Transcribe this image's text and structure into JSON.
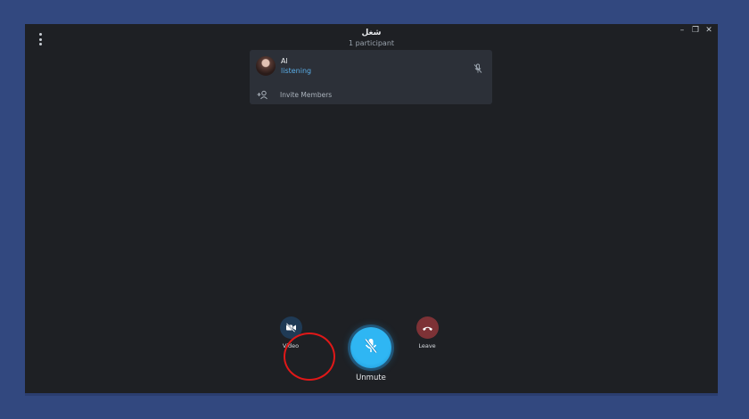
{
  "window": {
    "title": "شغل",
    "subtitle": "1 participant",
    "controls": {
      "minimize": "–",
      "maximize": "❐",
      "close": "✕"
    }
  },
  "participants": [
    {
      "name": "Al",
      "status": "listening",
      "muted": true
    }
  ],
  "invite": {
    "label": "Invite Members"
  },
  "controls": {
    "video_label": "Video",
    "unmute_label": "Unmute",
    "leave_label": "Leave"
  },
  "colors": {
    "accent": "#2fb6f3",
    "leave": "#7d3236",
    "status_listening": "#5aaee8",
    "highlight": "#e01818"
  }
}
